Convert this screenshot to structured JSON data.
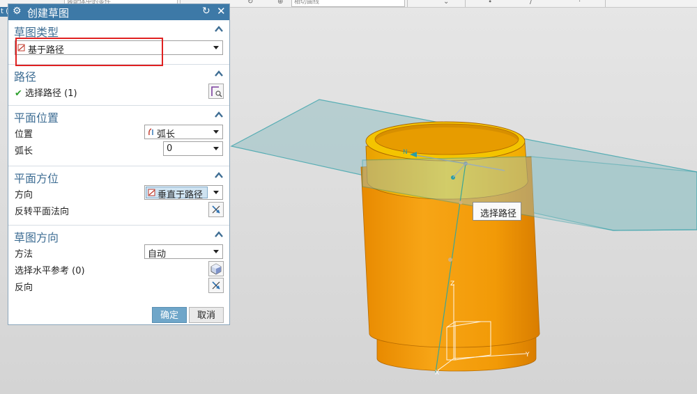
{
  "app": {
    "left_edge_text": "t ("
  },
  "topbar": {
    "field_a": "装配体中的零件",
    "field_b": "相切曲线"
  },
  "dialog": {
    "title": "创建草图",
    "sections": {
      "sketch_type": {
        "title": "草图类型",
        "value": "基于路径"
      },
      "path": {
        "title": "路径",
        "select_label": "选择路径 (1)"
      },
      "plane_location": {
        "title": "平面位置",
        "location_label": "位置",
        "location_value": "弧长",
        "arc_label": "弧长",
        "arc_value": "0"
      },
      "plane_orientation": {
        "title": "平面方位",
        "direction_label": "方向",
        "direction_value": "垂直于路径",
        "reverse_label": "反转平面法向"
      },
      "sketch_orientation": {
        "title": "草图方向",
        "method_label": "方法",
        "method_value": "自动",
        "horiz_ref_label": "选择水平参考 (0)",
        "reverse_label": "反向"
      }
    },
    "ok_label": "确定",
    "cancel_label": "取消"
  },
  "viewport": {
    "tooltip": "选择路径",
    "axes": {
      "x": "X",
      "y": "Y",
      "z": "Z",
      "n": "N"
    }
  },
  "colors": {
    "titlebar": "#3d79a7",
    "section_title": "#3f6e94",
    "model": "#f5a20d",
    "plane": "#8fbfc4",
    "highlight": "#e02020",
    "ok": "#6fa6c9"
  },
  "icons": [
    "gear-icon",
    "reset-icon",
    "close-icon",
    "chevron-up-icon",
    "check-icon",
    "path-select-icon",
    "arc-length-icon",
    "perpendicular-icon",
    "reverse-normal-icon",
    "horizontal-ref-icon",
    "reverse-icon",
    "sketch-type-icon"
  ]
}
